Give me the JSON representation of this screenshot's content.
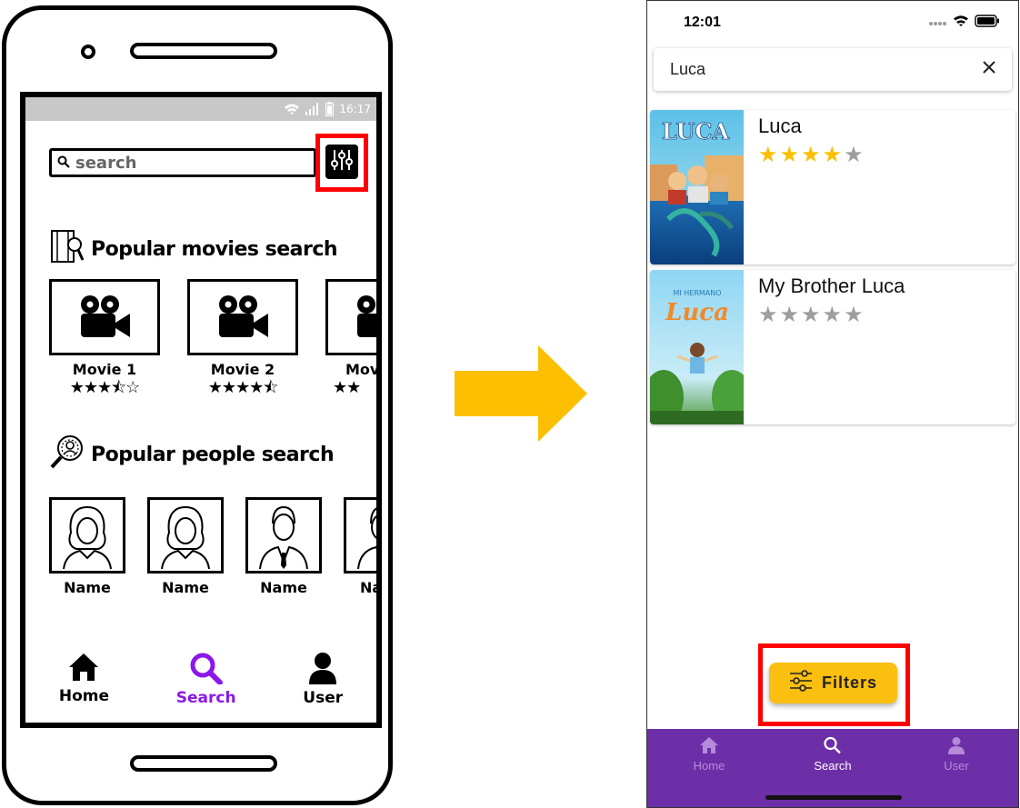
{
  "colors": {
    "arrow": "#fbbf00",
    "highlight": "#ff0000",
    "wireframe_active": "#8b18e8",
    "accent_yellow": "#fbbf0f",
    "nav_purple": "#6c2fa8",
    "nav_inactive": "#b48ad9",
    "star_filled": "#fbbf00",
    "star_empty": "#9e9e9e"
  },
  "wireframe": {
    "status_time": "16:17",
    "search_placeholder": "search",
    "popular_movies_title": "Popular movies search",
    "movies": [
      {
        "name": "Movie 1",
        "stars": "★★★⯪☆"
      },
      {
        "name": "Movie 2",
        "stars": "★★★★⯪"
      },
      {
        "name": "Mov",
        "stars": "★★"
      }
    ],
    "popular_people_title": "Popular people search",
    "people": [
      {
        "name": "Name"
      },
      {
        "name": "Name"
      },
      {
        "name": "Name"
      },
      {
        "name": "Na"
      }
    ],
    "nav": {
      "home": "Home",
      "search": "Search",
      "user": "User"
    }
  },
  "app": {
    "status_time": "12:01",
    "search_value": "Luca",
    "results": [
      {
        "title": "Luca",
        "rating": 4,
        "max": 5
      },
      {
        "title": "My Brother Luca",
        "rating": 0,
        "max": 5
      }
    ],
    "poster_texts": {
      "luca": "LUCA",
      "brother_top": "MI HERMANO",
      "brother_main": "Luca"
    },
    "filters_label": "Filters",
    "nav": {
      "home": "Home",
      "search": "Search",
      "user": "User"
    }
  }
}
